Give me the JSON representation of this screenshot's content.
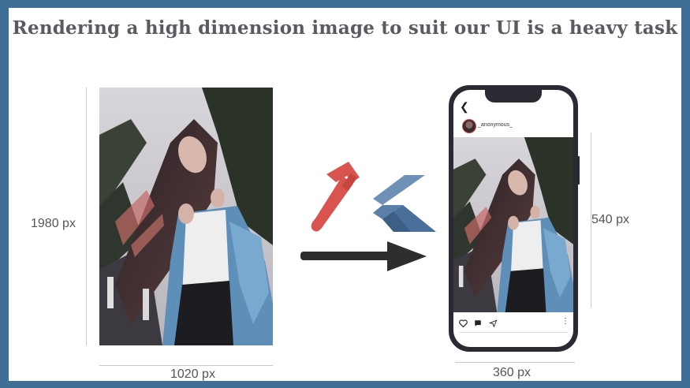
{
  "title": "Rendering a high dimension image to suit our UI is a heavy task",
  "large_image": {
    "height_label": "1980 px",
    "width_label": "1020 px"
  },
  "phone": {
    "username": "_anonymous_",
    "height_label": "540 px",
    "width_label": "360 px"
  },
  "icons": [
    "hammer-icon",
    "flutter-logo-icon",
    "arrow-right-icon",
    "back-arrow-icon",
    "heart-icon",
    "comment-icon",
    "send-icon",
    "more-vertical-icon"
  ],
  "colors": {
    "frame": "#3f6e96",
    "title": "#5a5a62",
    "hammer_head": "#d9534f",
    "flutter_blue": "#4a6f9a",
    "arrow": "#2e2e2e",
    "phone_body": "#2a2a33"
  }
}
